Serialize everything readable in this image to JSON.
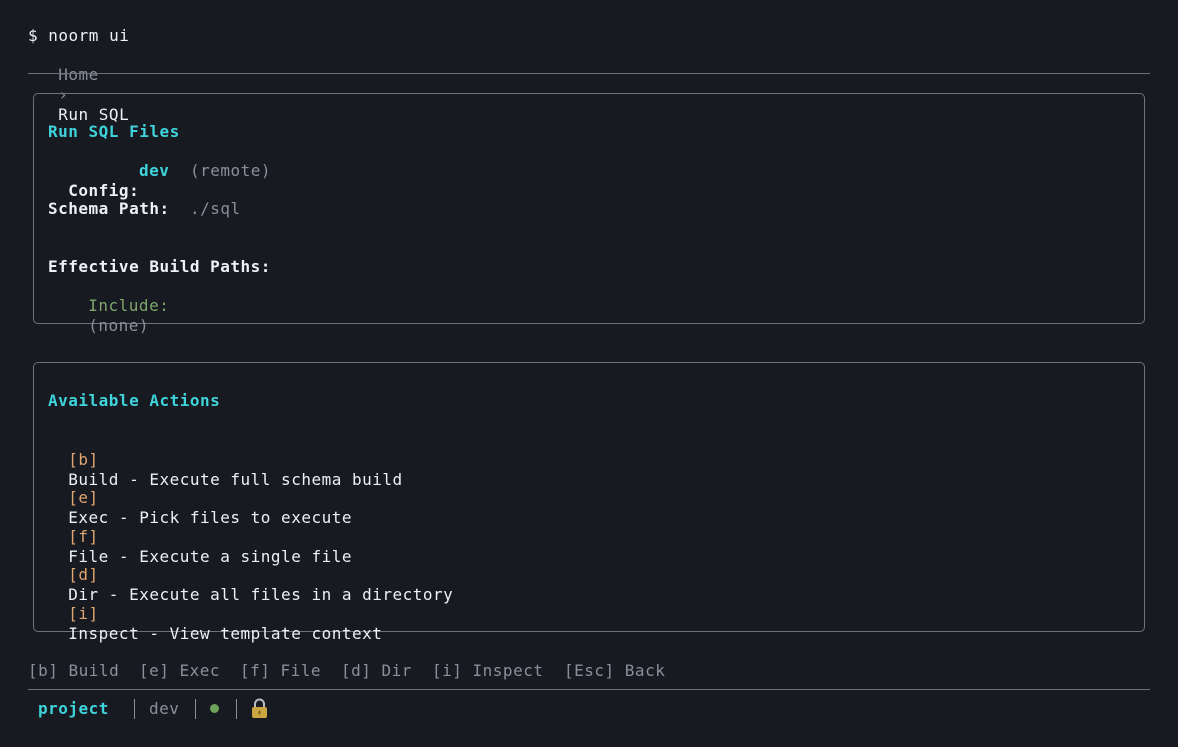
{
  "prompt": "$ noorm ui",
  "breadcrumb": {
    "home": "Home",
    "separator": "›",
    "current": "Run SQL"
  },
  "info_panel": {
    "title": "Run SQL Files",
    "config_label": "Config:",
    "config_value": "dev",
    "config_note": "(remote)",
    "schema_label": "Schema Path:",
    "schema_value": "./sql",
    "build_paths_label": "Effective Build Paths:",
    "include_label": "Include:",
    "include_value": "(none)"
  },
  "actions_panel": {
    "title": "Available Actions",
    "items": [
      {
        "key": "[b]",
        "text": "Build - Execute full schema build"
      },
      {
        "key": "[e]",
        "text": "Exec - Pick files to execute"
      },
      {
        "key": "[f]",
        "text": "File - Execute a single file"
      },
      {
        "key": "[d]",
        "text": "Dir - Execute all files in a directory"
      },
      {
        "key": "[i]",
        "text": "Inspect - View template context"
      }
    ]
  },
  "shortcuts": [
    "[b] Build",
    "[e] Exec",
    "[f] File",
    "[d] Dir",
    "[i] Inspect",
    "[Esc] Back"
  ],
  "status_bar": {
    "project": "project",
    "config": "dev",
    "connection_icon": "status-dot",
    "lock_icon": "lock-icon"
  },
  "colors": {
    "background": "#171a21",
    "accent": "#3fd3dc",
    "key": "#e0a56f",
    "include": "#7ea66a",
    "status_dot": "#6fa35a",
    "lock": "#c9a640"
  }
}
